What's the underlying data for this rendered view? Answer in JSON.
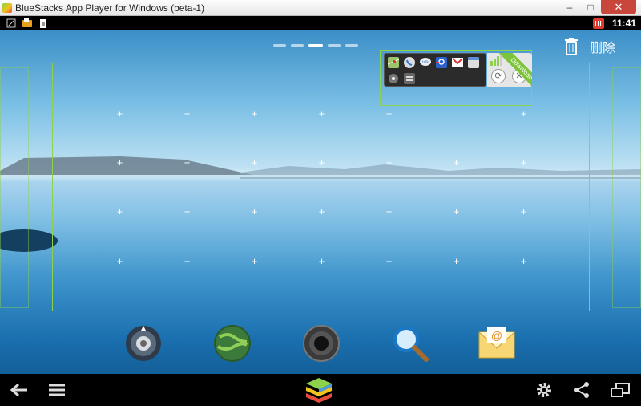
{
  "window": {
    "title": "BlueStacks App Player for Windows (beta-1)",
    "controls": {
      "minimize": "–",
      "maximize": "□",
      "close": "✕"
    }
  },
  "statusbar": {
    "left_icons": [
      "screenshot-icon",
      "notification-icon",
      "clipboard-icon"
    ],
    "calendar_icon": "calendar-icon",
    "time": "11:41"
  },
  "home": {
    "page_indicator": {
      "count": 5,
      "active_index": 2
    },
    "delete_label": "删除",
    "widget": {
      "name": "Download",
      "apps": [
        "maps-icon",
        "phone-icon",
        "talk-icon",
        "contacts-icon",
        "gmail-icon",
        "calendar-icon",
        "settings-icon",
        "equals-icon"
      ],
      "refresh": "⟳",
      "close": "✕"
    },
    "dock": [
      "compass-icon",
      "globe-icon",
      "camera-icon",
      "search-icon",
      "email-icon"
    ]
  },
  "navbar": {
    "back": "back-icon",
    "menu": "menu-icon",
    "home": "bluestacks-logo",
    "settings": "gear-icon",
    "share": "share-icon",
    "window": "window-icon"
  },
  "colors": {
    "accent": "#8ed14c",
    "sky": "#7cc0e5",
    "sea": "#1a6fae"
  }
}
